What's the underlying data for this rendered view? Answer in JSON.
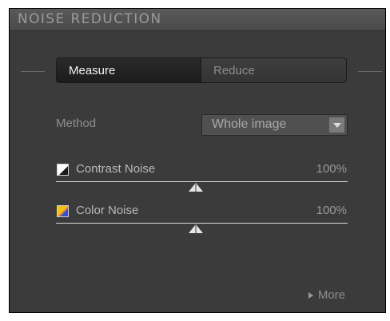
{
  "panel": {
    "title": "NOISE REDUCTION"
  },
  "tabs": [
    {
      "label": "Measure",
      "active": true
    },
    {
      "label": "Reduce",
      "active": false
    }
  ],
  "method": {
    "label": "Method",
    "selected": "Whole image"
  },
  "contrast_noise": {
    "label": "Contrast Noise",
    "value": "100%",
    "icon": "contrast-noise-swatch-icon"
  },
  "color_noise": {
    "label": "Color Noise",
    "value": "100%",
    "icon": "color-noise-swatch-icon"
  },
  "more": {
    "label": "More",
    "icon": "triangle-right-icon"
  },
  "colors": {
    "panel_bg": "#3b3b3b",
    "header_bg": "#4f4f4f",
    "active_tab_bg": "#1f1f1f",
    "inactive_tab_bg": "#383838",
    "dropdown_bg": "#505050",
    "color_swatch_yellow": "#f2c21a",
    "color_swatch_blue": "#3a4fd8"
  }
}
